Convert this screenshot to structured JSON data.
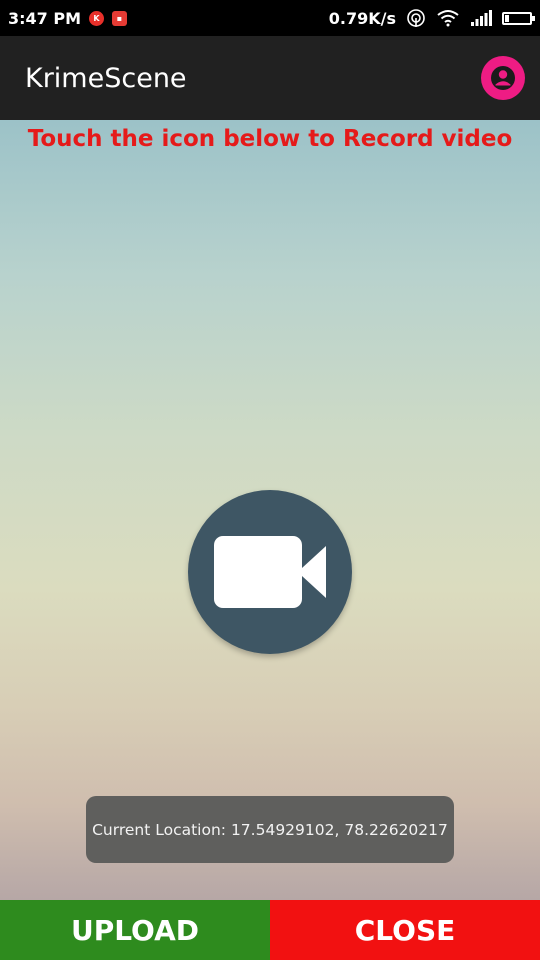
{
  "status_bar": {
    "time": "3:47 PM",
    "net_speed": "0.79K/s",
    "battery_level": 0.15,
    "icons": [
      "k-app-icon",
      "chat-app-icon",
      "hotspot-icon",
      "wifi-icon",
      "signal-icon",
      "battery-icon"
    ]
  },
  "app_bar": {
    "title": "KrimeScene",
    "profile_icon": "account-circle-icon",
    "accent": "#ee1c84"
  },
  "main": {
    "instruction": "Touch the icon below to Record video",
    "record_icon": "video-camera-icon",
    "toast": "Current Location: 17.54929102, 78.22620217"
  },
  "actions": {
    "upload_label": "UPLOAD",
    "close_label": "CLOSE",
    "upload_color": "#2e8b1e",
    "close_color": "#f21111"
  }
}
